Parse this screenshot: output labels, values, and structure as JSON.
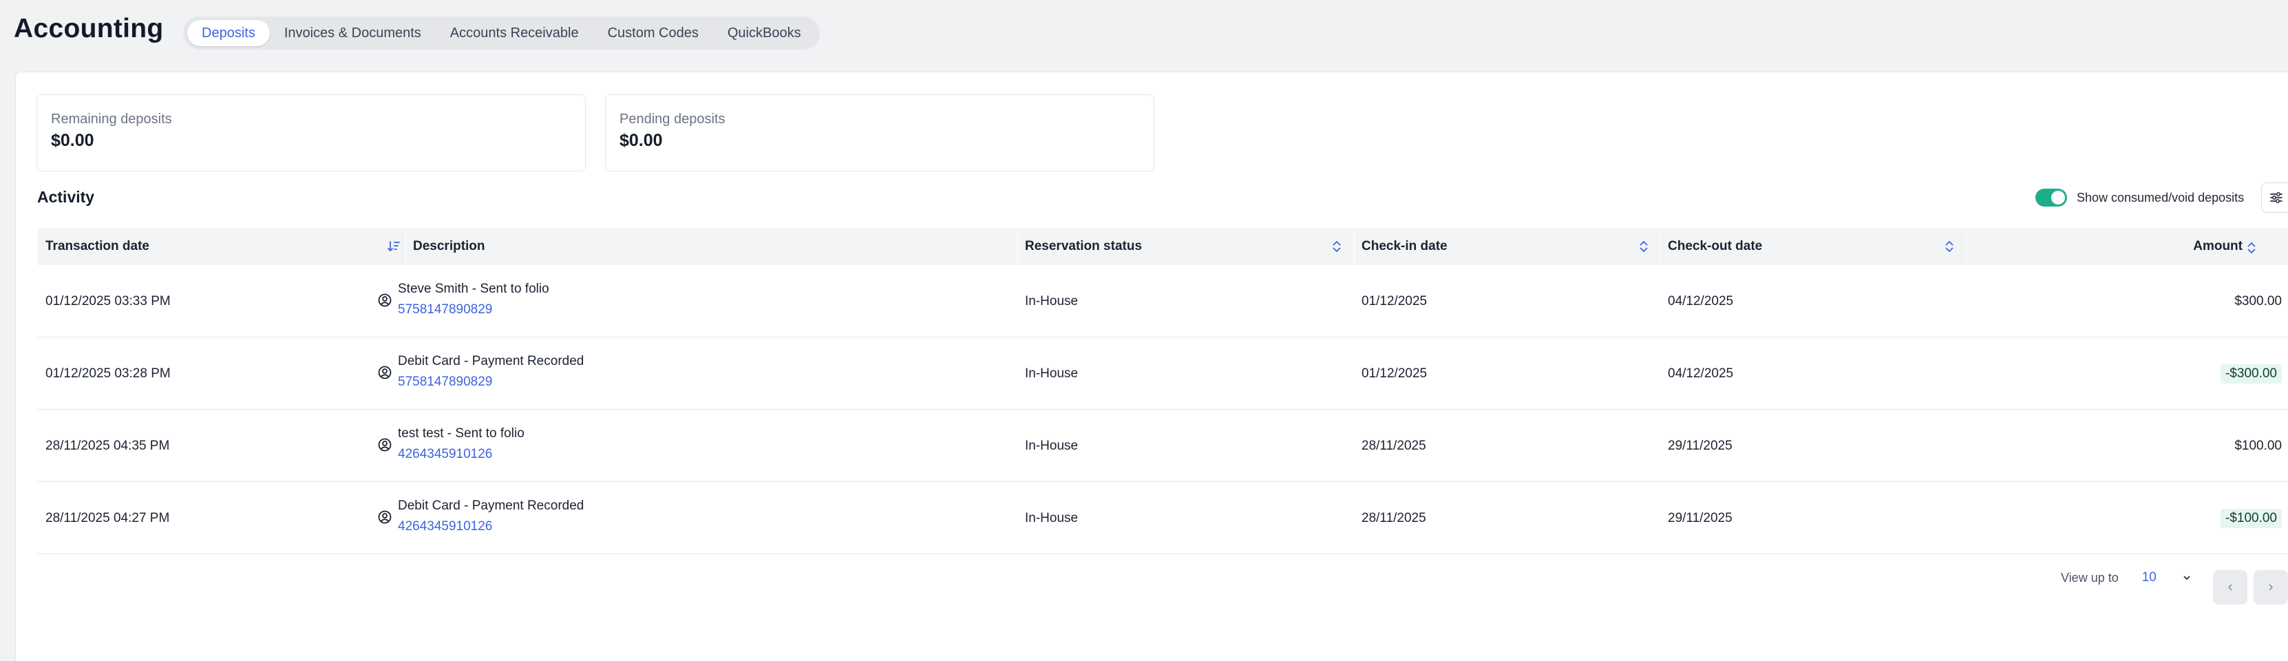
{
  "app": {
    "title": "Accounting"
  },
  "tabs": [
    {
      "label": "Deposits",
      "active": true
    },
    {
      "label": "Invoices & Documents",
      "active": false
    },
    {
      "label": "Accounts Receivable",
      "active": false
    },
    {
      "label": "Custom Codes",
      "active": false
    },
    {
      "label": "QuickBooks",
      "active": false
    }
  ],
  "summary": {
    "remaining": {
      "label": "Remaining deposits",
      "value": "$0.00"
    },
    "pending": {
      "label": "Pending deposits",
      "value": "$0.00"
    }
  },
  "activity": {
    "title": "Activity",
    "toggle_label": "Show consumed/void deposits",
    "toggle_on": true
  },
  "table": {
    "columns": {
      "transaction_date": "Transaction date",
      "description": "Description",
      "reservation_status": "Reservation status",
      "checkin": "Check-in date",
      "checkout": "Check-out date",
      "amount": "Amount"
    },
    "rows": [
      {
        "date": "01/12/2025 03:33 PM",
        "desc": "Steve Smith - Sent to folio",
        "ref": "5758147890829",
        "status": "In-House",
        "checkin": "01/12/2025",
        "checkout": "04/12/2025",
        "amount": "$300.00",
        "negative": false
      },
      {
        "date": "01/12/2025 03:28 PM",
        "desc": "Debit Card - Payment Recorded",
        "ref": "5758147890829",
        "status": "In-House",
        "checkin": "01/12/2025",
        "checkout": "04/12/2025",
        "amount": "-$300.00",
        "negative": true
      },
      {
        "date": "28/11/2025 04:35 PM",
        "desc": "test test - Sent to folio",
        "ref": "4264345910126",
        "status": "In-House",
        "checkin": "28/11/2025",
        "checkout": "29/11/2025",
        "amount": "$100.00",
        "negative": false
      },
      {
        "date": "28/11/2025 04:27 PM",
        "desc": "Debit Card - Payment Recorded",
        "ref": "4264345910126",
        "status": "In-House",
        "checkin": "28/11/2025",
        "checkout": "29/11/2025",
        "amount": "-$100.00",
        "negative": true
      }
    ]
  },
  "pagination": {
    "view_label": "View up to",
    "page_size": "10"
  },
  "colors": {
    "accent": "#3e63dd",
    "toggle": "#1fae8d",
    "negative_bg": "#e6f6ef"
  }
}
